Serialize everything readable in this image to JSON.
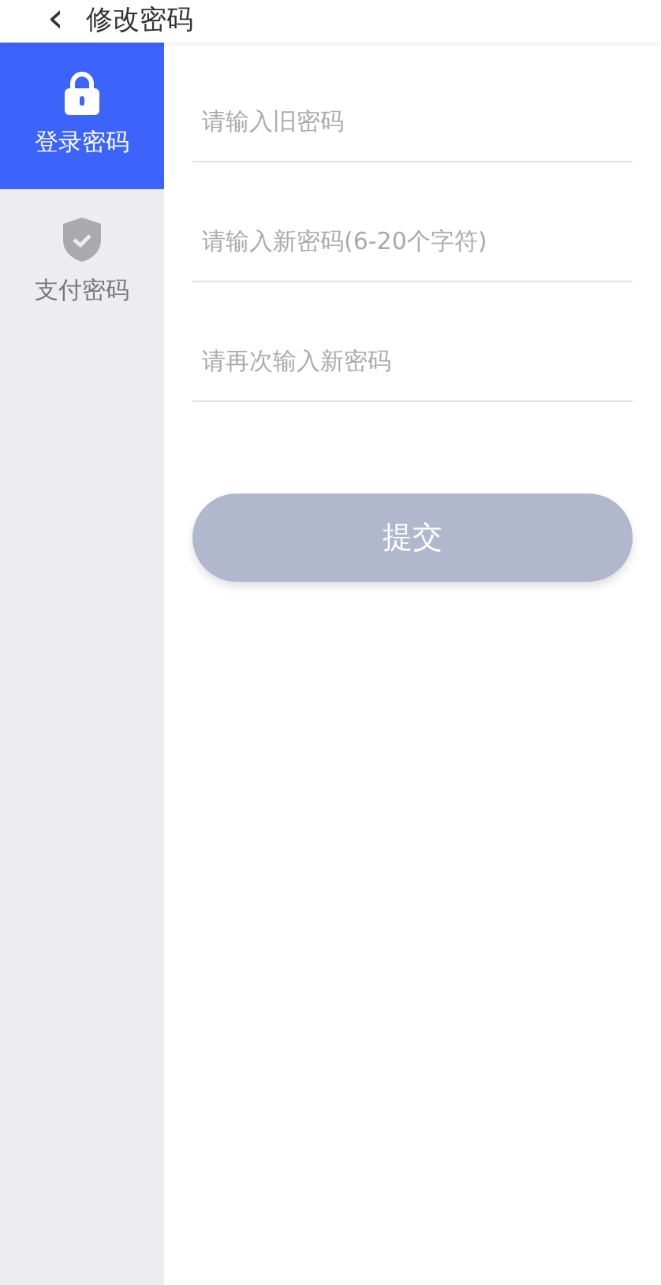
{
  "header": {
    "back_icon": "‹",
    "title": "修改密码"
  },
  "sidebar": {
    "items": [
      {
        "label": "登录密码",
        "selected": true
      },
      {
        "label": "支付密码",
        "selected": false
      }
    ]
  },
  "form": {
    "fields": [
      {
        "placeholder": "请输入旧密码"
      },
      {
        "placeholder": "请输入新密码(6-20个字符)"
      },
      {
        "placeholder": "请再次输入新密码"
      }
    ],
    "submit": {
      "label": "提交",
      "disabled": true
    }
  }
}
